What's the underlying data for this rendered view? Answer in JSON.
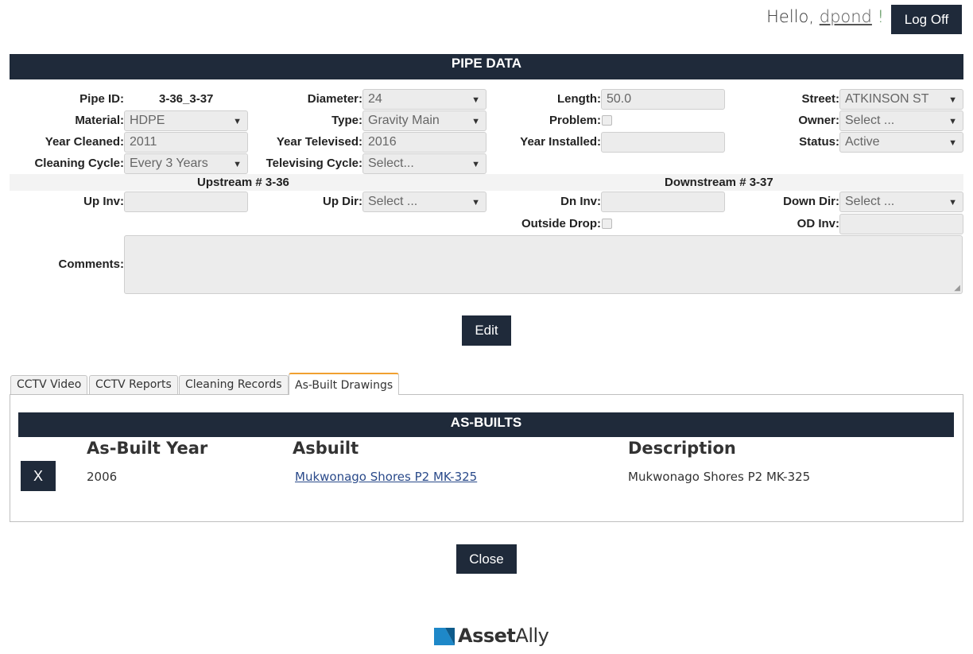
{
  "header": {
    "greeting": "Hello,",
    "username": "dpond",
    "exclaim": "!",
    "logoff_label": "Log Off"
  },
  "pipe": {
    "title": "PIPE DATA",
    "pipe_id_label": "Pipe ID:",
    "pipe_id": "3-36_3-37",
    "diameter_label": "Diameter:",
    "diameter": "24",
    "length_label": "Length:",
    "length": "50.0",
    "street_label": "Street:",
    "street": "ATKINSON ST",
    "material_label": "Material:",
    "material": "HDPE",
    "type_label": "Type:",
    "type": "Gravity Main",
    "problem_label": "Problem:",
    "owner_label": "Owner:",
    "owner": "Select ...",
    "year_cleaned_label": "Year Cleaned:",
    "year_cleaned": "2011",
    "year_televised_label": "Year Televised:",
    "year_televised": "2016",
    "year_installed_label": "Year Installed:",
    "year_installed": "",
    "status_label": "Status:",
    "status": "Active",
    "cleaning_cycle_label": "Cleaning Cycle:",
    "cleaning_cycle": "Every 3 Years",
    "televising_cycle_label": "Televising Cycle:",
    "televising_cycle": "Select...",
    "upstream_title": "Upstream # 3-36",
    "downstream_title": "Downstream # 3-37",
    "up_inv_label": "Up Inv:",
    "up_inv": "",
    "up_dir_label": "Up Dir:",
    "up_dir": "Select ...",
    "dn_inv_label": "Dn Inv:",
    "dn_inv": "",
    "down_dir_label": "Down Dir:",
    "down_dir": "Select ...",
    "outside_drop_label": "Outside Drop:",
    "od_inv_label": "OD Inv:",
    "od_inv": "",
    "comments_label": "Comments:",
    "comments": "",
    "edit_label": "Edit"
  },
  "tabs": [
    {
      "label": "CCTV Video"
    },
    {
      "label": "CCTV Reports"
    },
    {
      "label": "Cleaning Records"
    },
    {
      "label": "As-Built Drawings",
      "active": true
    }
  ],
  "asbuilts": {
    "title": "AS-BUILTS",
    "columns": [
      "As-Built Year",
      "Asbuilt",
      "Description"
    ],
    "rows": [
      {
        "delete_label": "X",
        "year": "2006",
        "asbuilt": "Mukwonago Shores P2 MK-325",
        "description": "Mukwonago Shores P2 MK-325"
      }
    ]
  },
  "close_label": "Close",
  "logo": {
    "part1": "Asset",
    "part2": "Ally"
  },
  "icons": {
    "dropdown": "chevron-down-icon",
    "logo": "assetally-logo-icon"
  },
  "colors": {
    "navy": "#1f2a3a",
    "tab_accent": "#f0a030",
    "link": "#2a4a8a"
  }
}
